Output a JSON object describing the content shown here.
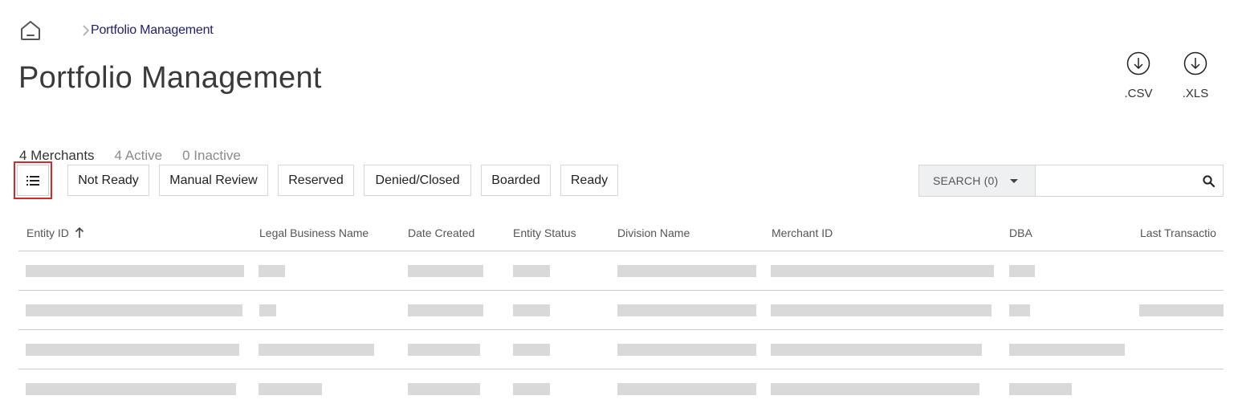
{
  "breadcrumb": {
    "current": "Portfolio Management"
  },
  "page": {
    "title": "Portfolio Management"
  },
  "exports": {
    "csv_label": ".CSV",
    "xls_label": ".XLS"
  },
  "summary": {
    "merchants": "4 Merchants",
    "active": "4 Active",
    "inactive": "0 Inactive"
  },
  "filters": [
    "Not Ready",
    "Manual Review",
    "Reserved",
    "Denied/Closed",
    "Boarded",
    "Ready"
  ],
  "search": {
    "selector_label": "SEARCH (0)",
    "value": ""
  },
  "table": {
    "columns": [
      "Entity ID",
      "Legal Business Name",
      "Date Created",
      "Entity Status",
      "Division Name",
      "Merchant ID",
      "DBA",
      "Last Transactio"
    ],
    "sorted_column": "Entity ID",
    "sort_direction": "ascending",
    "row_count": 4,
    "rows_loading": true
  },
  "colors": {
    "breadcrumb_link": "#1e1e6e",
    "highlight_border": "#d62828",
    "placeholder": "#d9d9d9",
    "search_select_bg": "#eef0f2"
  }
}
